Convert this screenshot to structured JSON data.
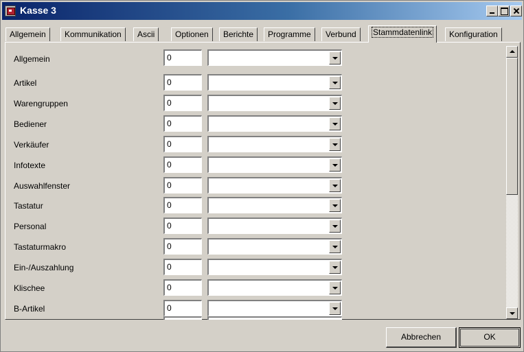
{
  "window": {
    "title": "Kasse 3",
    "controls": {
      "minimize": "minimize",
      "maximize": "maximize",
      "close": "close"
    }
  },
  "tabs": [
    {
      "label": "Allgemein"
    },
    {
      "label": "Kommunikation"
    },
    {
      "label": "Ascii"
    },
    {
      "label": "Optionen"
    },
    {
      "label": "Berichte"
    },
    {
      "label": "Programme"
    },
    {
      "label": "Verbund"
    },
    {
      "label": "Stammdatenlink",
      "active": true
    },
    {
      "label": "Konfiguration"
    }
  ],
  "rows": [
    {
      "label": "Allgemein",
      "value": "0",
      "combo": ""
    },
    {
      "label": "Artikel",
      "value": "0",
      "combo": ""
    },
    {
      "label": "Warengruppen",
      "value": "0",
      "combo": ""
    },
    {
      "label": "Bediener",
      "value": "0",
      "combo": ""
    },
    {
      "label": "Verkäufer",
      "value": "0",
      "combo": ""
    },
    {
      "label": "Infotexte",
      "value": "0",
      "combo": ""
    },
    {
      "label": "Auswahlfenster",
      "value": "0",
      "combo": ""
    },
    {
      "label": "Tastatur",
      "value": "0",
      "combo": ""
    },
    {
      "label": "Personal",
      "value": "0",
      "combo": ""
    },
    {
      "label": "Tastaturmakro",
      "value": "0",
      "combo": ""
    },
    {
      "label": "Ein-/Auszahlung",
      "value": "0",
      "combo": ""
    },
    {
      "label": "Klischee",
      "value": "0",
      "combo": ""
    },
    {
      "label": "B-Artikel",
      "value": "0",
      "combo": ""
    }
  ],
  "buttons": {
    "cancel": "Abbrechen",
    "ok": "OK"
  }
}
